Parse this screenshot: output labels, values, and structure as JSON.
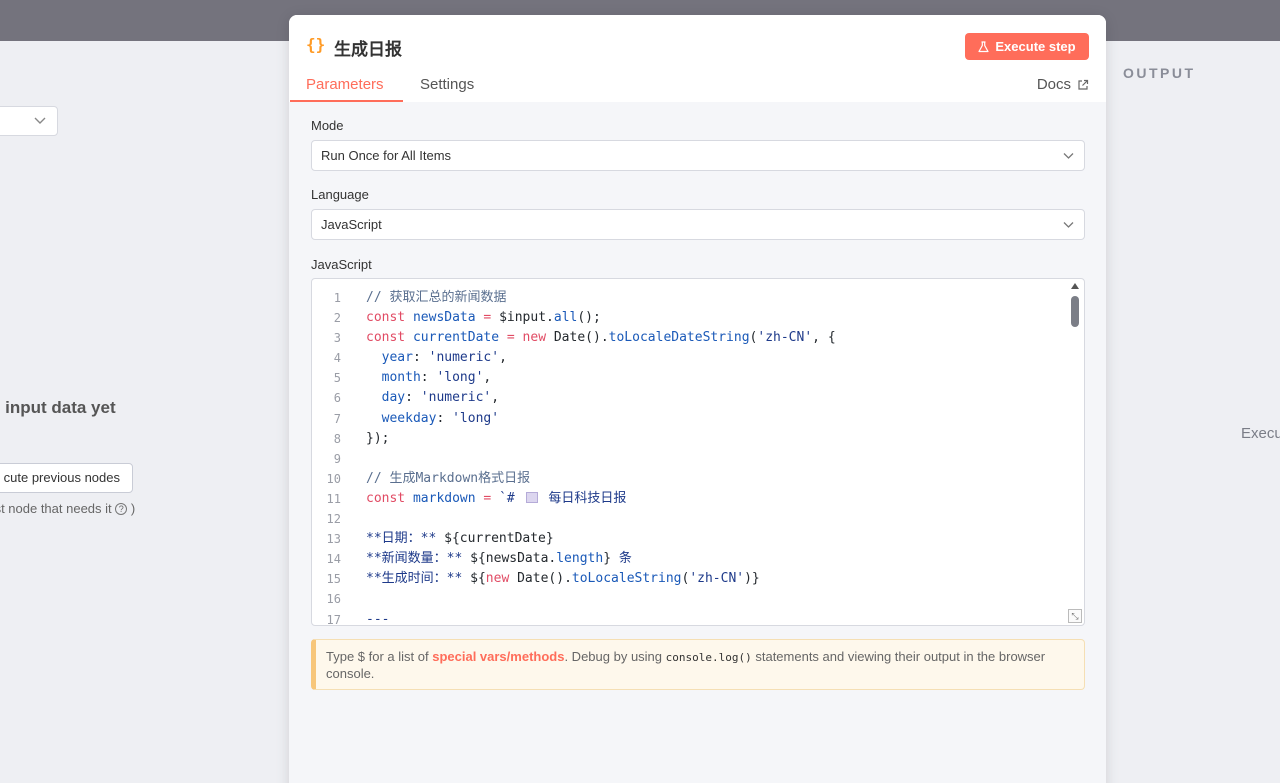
{
  "left_panel": {
    "no_input_text": "o input data yet",
    "execute_previous_label": "cute previous nodes",
    "earliest_text": "arliest node that needs it",
    "earliest_suffix": " )"
  },
  "right_panel": {
    "output_label": "OUTPUT",
    "execute_text": "Execu"
  },
  "modal": {
    "icon_text": "{}",
    "title": "生成日报",
    "execute_step_label": "Execute step",
    "tabs": [
      {
        "label": "Parameters",
        "active": true
      },
      {
        "label": "Settings",
        "active": false
      }
    ],
    "docs_label": "Docs",
    "mode": {
      "label": "Mode",
      "value": "Run Once for All Items"
    },
    "language": {
      "label": "Language",
      "value": "JavaScript"
    },
    "code_label": "JavaScript",
    "code_lines": [
      {
        "n": "1",
        "segments": [
          {
            "t": "// 获取汇总的新闻数据",
            "c": "comment"
          }
        ]
      },
      {
        "n": "2",
        "segments": [
          {
            "t": "const ",
            "c": "kw"
          },
          {
            "t": "newsData",
            "c": "var"
          },
          {
            "t": " = ",
            "c": "kw"
          },
          {
            "t": "$input.",
            "c": "plain"
          },
          {
            "t": "all",
            "c": "var"
          },
          {
            "t": "();",
            "c": "plain"
          }
        ]
      },
      {
        "n": "3",
        "segments": [
          {
            "t": "const ",
            "c": "kw"
          },
          {
            "t": "currentDate",
            "c": "var"
          },
          {
            "t": " = ",
            "c": "kw"
          },
          {
            "t": "new ",
            "c": "kw"
          },
          {
            "t": "Date().",
            "c": "plain"
          },
          {
            "t": "toLocaleDateString",
            "c": "var"
          },
          {
            "t": "(",
            "c": "plain"
          },
          {
            "t": "'zh-CN'",
            "c": "str"
          },
          {
            "t": ", {",
            "c": "plain"
          }
        ]
      },
      {
        "n": "4",
        "segments": [
          {
            "t": "  year",
            "c": "var"
          },
          {
            "t": ": ",
            "c": "plain"
          },
          {
            "t": "'numeric'",
            "c": "str"
          },
          {
            "t": ",",
            "c": "plain"
          }
        ]
      },
      {
        "n": "5",
        "segments": [
          {
            "t": "  month",
            "c": "var"
          },
          {
            "t": ": ",
            "c": "plain"
          },
          {
            "t": "'long'",
            "c": "str"
          },
          {
            "t": ",",
            "c": "plain"
          }
        ]
      },
      {
        "n": "6",
        "segments": [
          {
            "t": "  day",
            "c": "var"
          },
          {
            "t": ": ",
            "c": "plain"
          },
          {
            "t": "'numeric'",
            "c": "str"
          },
          {
            "t": ",",
            "c": "plain"
          }
        ]
      },
      {
        "n": "7",
        "segments": [
          {
            "t": "  weekday",
            "c": "var"
          },
          {
            "t": ": ",
            "c": "plain"
          },
          {
            "t": "'long'",
            "c": "str"
          }
        ]
      },
      {
        "n": "8",
        "segments": [
          {
            "t": "});",
            "c": "plain"
          }
        ]
      },
      {
        "n": "9",
        "segments": []
      },
      {
        "n": "10",
        "segments": [
          {
            "t": "// 生成Markdown格式日报",
            "c": "comment"
          }
        ]
      },
      {
        "n": "11",
        "segments": [
          {
            "t": "const ",
            "c": "kw"
          },
          {
            "t": "markdown",
            "c": "var"
          },
          {
            "t": " = ",
            "c": "kw"
          },
          {
            "t": "`# ",
            "c": "str"
          },
          {
            "t": "ICON",
            "c": "icon"
          },
          {
            "t": " 每日科技日报",
            "c": "str"
          }
        ]
      },
      {
        "n": "12",
        "segments": []
      },
      {
        "n": "13",
        "segments": [
          {
            "t": "**日期：** ",
            "c": "str"
          },
          {
            "t": "${currentDate}",
            "c": "plain"
          }
        ]
      },
      {
        "n": "14",
        "segments": [
          {
            "t": "**新闻数量：** ",
            "c": "str"
          },
          {
            "t": "${newsData.",
            "c": "plain"
          },
          {
            "t": "length",
            "c": "var"
          },
          {
            "t": "} ",
            "c": "plain"
          },
          {
            "t": "条",
            "c": "str"
          }
        ]
      },
      {
        "n": "15",
        "segments": [
          {
            "t": "**生成时间：** ",
            "c": "str"
          },
          {
            "t": "${",
            "c": "plain"
          },
          {
            "t": "new ",
            "c": "kw"
          },
          {
            "t": "Date().",
            "c": "plain"
          },
          {
            "t": "toLocaleString",
            "c": "var"
          },
          {
            "t": "(",
            "c": "plain"
          },
          {
            "t": "'zh-CN'",
            "c": "str"
          },
          {
            "t": ")}",
            "c": "plain"
          }
        ]
      },
      {
        "n": "16",
        "segments": []
      },
      {
        "n": "17",
        "segments": [
          {
            "t": "---",
            "c": "str"
          }
        ]
      }
    ],
    "hint": {
      "prefix": "Type $ for a list of ",
      "link": "special vars/methods",
      "middle": ". Debug by using ",
      "code": "console.log()",
      "suffix": " statements and viewing their output in the browser console."
    }
  },
  "colors": {
    "accent": "#ff6d5a",
    "node_icon": "#ff9b26",
    "top_strip": "#74737d"
  }
}
